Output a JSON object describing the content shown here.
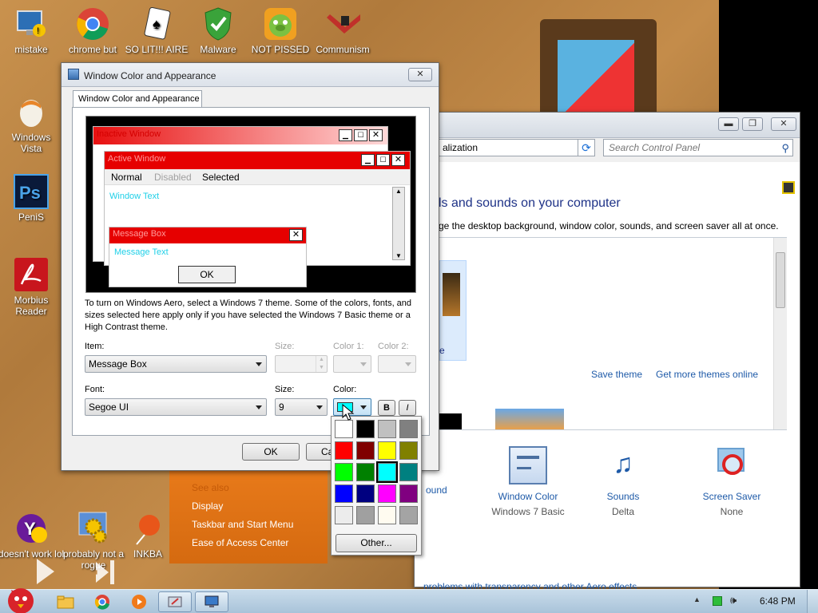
{
  "desktop": {
    "icons_top": [
      {
        "label": "mistake",
        "icon": "monitor-icon"
      },
      {
        "label": "chrome but",
        "icon": "chrome-icon"
      },
      {
        "label": "SO LIT!!! AIRE",
        "icon": "solitaire-icon"
      },
      {
        "label": "Malware",
        "icon": "shield-icon"
      },
      {
        "label": "NOT PISSED",
        "icon": "pig-icon"
      },
      {
        "label": "Communism",
        "icon": "emblem-icon"
      }
    ],
    "icons_left": [
      {
        "label": "Windows Vista",
        "icon": "egg-icon"
      },
      {
        "label": "PeniS",
        "icon": "photoshop-icon"
      },
      {
        "label": "Morbius Reader",
        "icon": "pdf-icon"
      }
    ],
    "icons_bottom": [
      {
        "label": "doesn't work lol",
        "icon": "yahoo-icon"
      },
      {
        "label": "probably not a rogue",
        "icon": "gears-icon"
      },
      {
        "label": "INKBA",
        "icon": "balloon-icon"
      }
    ]
  },
  "dialog": {
    "title": "Window Color and Appearance",
    "tab": "Window Color and Appearance",
    "preview": {
      "inactive_title": "Inactive Window",
      "active_title": "Active Window",
      "menu": [
        "Normal",
        "Disabled",
        "Selected"
      ],
      "window_text": "Window Text",
      "msgbox_title": "Message Box",
      "msg_text": "Message Text",
      "ok": "OK"
    },
    "description": "To turn on Windows Aero, select a Windows 7 theme.  Some of the colors, fonts, and sizes selected here apply only if you have selected the Windows 7 Basic theme or a High Contrast theme.",
    "item_label": "Item:",
    "item_value": "Message Box",
    "size_label": "Size:",
    "color1_label": "Color 1:",
    "color2_label": "Color 2:",
    "font_label": "Font:",
    "font_value": "Segoe UI",
    "font_size_label": "Size:",
    "font_size_value": "9",
    "color_label": "Color:",
    "bold": "B",
    "italic": "I",
    "ok": "OK",
    "cancel": "Ca",
    "selected_color": "#00ffff",
    "palette": [
      "#ffffff",
      "#000000",
      "#c0c0c0",
      "#808080",
      "#ff0000",
      "#800000",
      "#ffff00",
      "#808000",
      "#00ff00",
      "#008000",
      "#00ffff",
      "#008080",
      "#0000ff",
      "#000080",
      "#ff00ff",
      "#800080",
      "#ececec",
      "#a0a0a0",
      "#fffbf0",
      "#a4a4a4"
    ],
    "other": "Other..."
  },
  "control_panel": {
    "address": "alization",
    "search_placeholder": "Search Control Panel",
    "heading": "ls and sounds on your computer",
    "subtext": "ge the desktop background, window color, sounds, and screen saver all at once.",
    "save_theme": "Save theme",
    "get_more": "Get more themes online",
    "partial_label": "e",
    "see_also": "See also",
    "links": [
      "Display",
      "Taskbar and Start Menu",
      "Ease of Access Center"
    ],
    "items": [
      {
        "title": "ound",
        "sub": ""
      },
      {
        "title": "Window Color",
        "sub": "Windows 7 Basic"
      },
      {
        "title": "Sounds",
        "sub": "Delta"
      },
      {
        "title": "Screen Saver",
        "sub": "None"
      }
    ],
    "troubleshoot": "problems with transparency and other Aero effects"
  },
  "taskbar": {
    "time": "6:48 PM"
  }
}
